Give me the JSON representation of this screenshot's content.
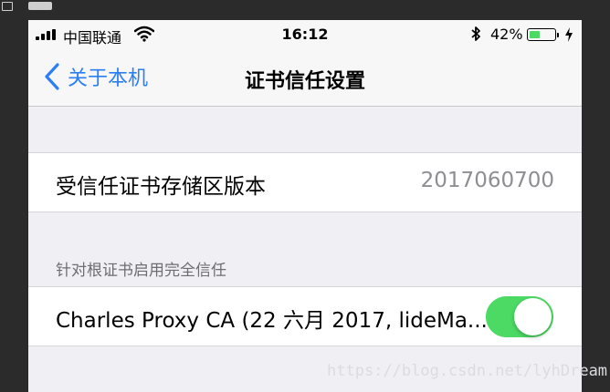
{
  "status_bar": {
    "carrier": "中国联通",
    "time": "16:12",
    "battery_percent_label": "42%",
    "battery_level": 0.42,
    "signal_bars": 4,
    "icons": [
      "signal-icon",
      "wifi-icon",
      "bluetooth-icon",
      "battery-icon",
      "charging-icon"
    ]
  },
  "nav_bar": {
    "back_label": "关于本机",
    "title": "证书信任设置"
  },
  "trust_store": {
    "label": "受信任证书存储区版本",
    "value": "2017060700"
  },
  "full_trust_section": {
    "header": "针对根证书启用完全信任",
    "items": [
      {
        "label": "Charles Proxy CA (22 六月 2017, lideMa...",
        "enabled": true
      }
    ]
  },
  "watermark": "https://blog.csdn.net/lyhDream",
  "colors": {
    "accent": "#2b7ef3",
    "toggle_on": "#4cd964",
    "background": "#efeff4",
    "secondary_text": "#8e8e93"
  }
}
